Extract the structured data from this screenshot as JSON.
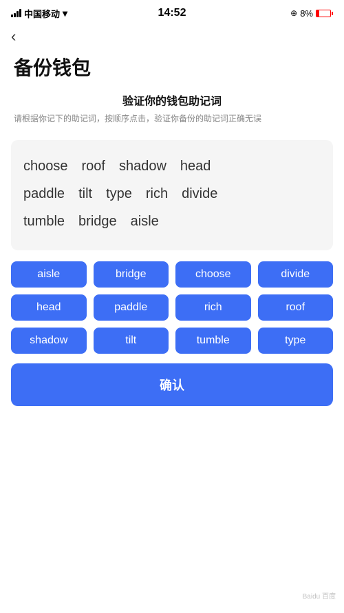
{
  "statusBar": {
    "carrier": "中国移动",
    "time": "14:52",
    "battery": "8%"
  },
  "nav": {
    "backLabel": "‹"
  },
  "pageTitle": "备份钱包",
  "instruction": {
    "title": "验证你的钱包助记词",
    "desc": "请根据你记下的助记词，按顺序点击，验证你备份的助记词正确无误"
  },
  "displayWords": [
    [
      "choose",
      "roof",
      "shadow",
      "head"
    ],
    [
      "paddle",
      "tilt",
      "type",
      "rich",
      "divide"
    ],
    [
      "tumble",
      "bridge",
      "aisle"
    ]
  ],
  "selectionWords": [
    "aisle",
    "bridge",
    "choose",
    "divide",
    "head",
    "paddle",
    "rich",
    "roof",
    "shadow",
    "tilt",
    "tumble",
    "type"
  ],
  "confirmButton": {
    "label": "确认"
  }
}
